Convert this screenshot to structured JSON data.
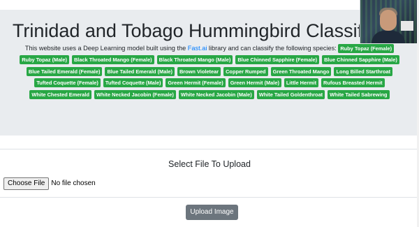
{
  "header": {
    "title": "Trinidad and Tobago Hummingbird Classifier",
    "lead_before": "This website uses a Deep Learning model built using the ",
    "lead_link": "Fast.ai",
    "lead_after": " library and can classify the following species: "
  },
  "species": [
    "Ruby Topaz (Female)",
    "Ruby Topaz (Male)",
    "Black Throated Mango (Female)",
    "Black Throated Mango (Male)",
    "Blue Chinned Sapphire (Female)",
    "Blue Chinned Sapphire (Male)",
    "Blue Tailed Emerald (Female)",
    "Blue Tailed Emerald (Male)",
    "Brown Violetear",
    "Copper Rumped",
    "Green Throated Mango",
    "Long Billed Starthroat",
    "Tufted Coquette (Female)",
    "Tufted Coquette (Male)",
    "Green Hermit (Female)",
    "Green Hermit (Male)",
    "Little Hermit",
    "Rufous Breasted Hermit",
    "White Chested Emerald",
    "White Necked Jacobin (Female)",
    "White Necked Jacobin (Male)",
    "White Tailed Goldenthroat",
    "White Tailed Sabrewing"
  ],
  "upload": {
    "title": "Select File To Upload",
    "choose_label": "Choose File",
    "no_file_label": "No file chosen",
    "submit_label": "Upload Image"
  },
  "colors": {
    "badge": "#28a745",
    "jumbotron": "#e9ecef",
    "link": "#007bff",
    "button": "#6c757d"
  }
}
